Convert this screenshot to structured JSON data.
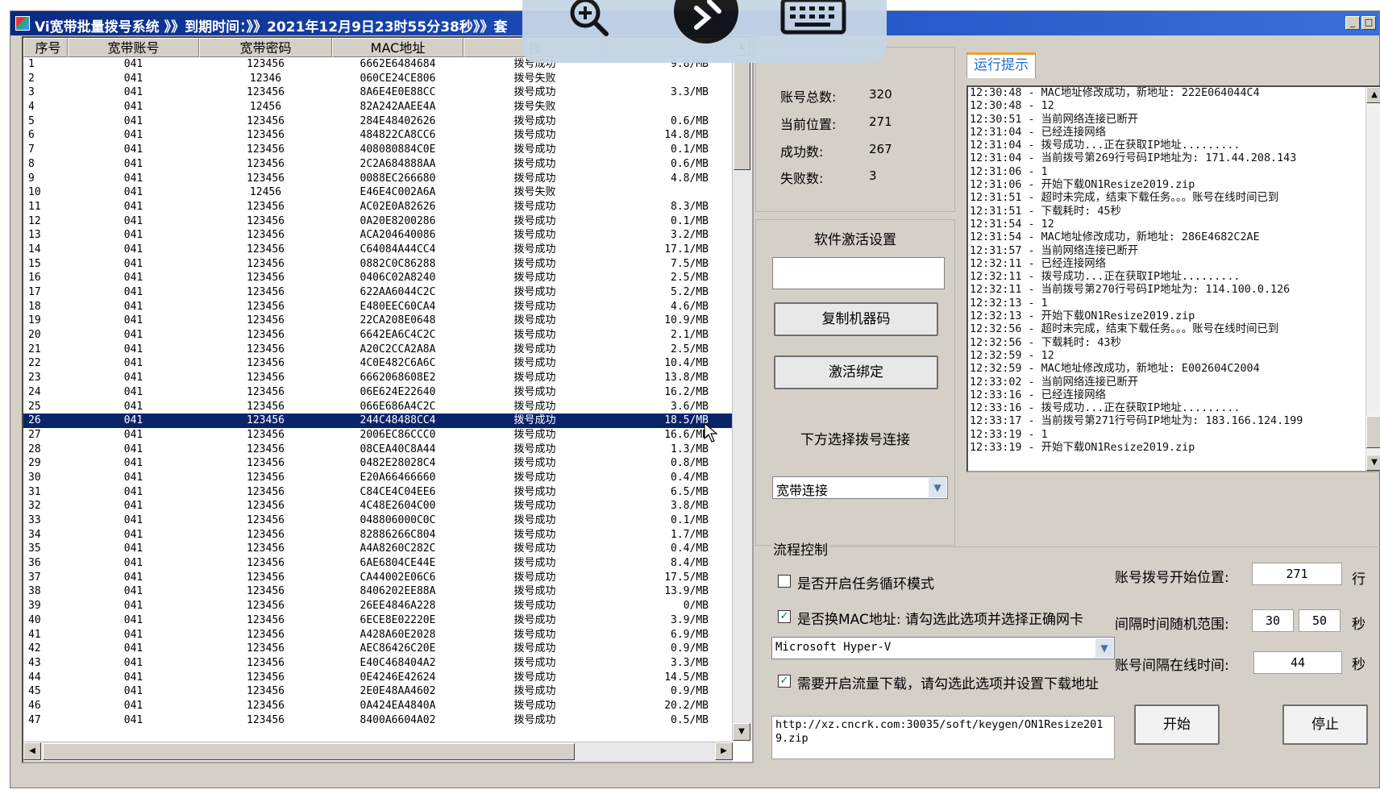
{
  "window": {
    "title": "Vi宽带批量拨号系统 》》到期时间：》》2021年12月9日23时55分38秒》》套"
  },
  "table": {
    "headers": [
      "序号",
      "宽带账号",
      "宽带密码",
      "MAC地址",
      "拨",
      ""
    ],
    "rows": [
      [
        "1",
        "041",
        "123456",
        "6662E6484684",
        "拨号成功",
        "9.8/MB"
      ],
      [
        "2",
        "041",
        "12346",
        "060CE24CE806",
        "拨号失败",
        ""
      ],
      [
        "3",
        "041",
        "123456",
        "8A6E4E0E88CC",
        "拨号成功",
        "3.3/MB"
      ],
      [
        "4",
        "041",
        "12456",
        "82A242AAEE4A",
        "拨号失败",
        ""
      ],
      [
        "5",
        "041",
        "123456",
        "284E48402626",
        "拨号成功",
        "0.6/MB"
      ],
      [
        "6",
        "041",
        "123456",
        "484822CA8CC6",
        "拨号成功",
        "14.8/MB"
      ],
      [
        "7",
        "041",
        "123456",
        "408080884C0E",
        "拨号成功",
        "0.1/MB"
      ],
      [
        "8",
        "041",
        "123456",
        "2C2A684888AA",
        "拨号成功",
        "0.6/MB"
      ],
      [
        "9",
        "041",
        "123456",
        "0088EC266680",
        "拨号成功",
        "4.8/MB"
      ],
      [
        "10",
        "041",
        "12456",
        "E46E4C002A6A",
        "拨号失败",
        ""
      ],
      [
        "11",
        "041",
        "123456",
        "AC02E0A82626",
        "拨号成功",
        "8.3/MB"
      ],
      [
        "12",
        "041",
        "123456",
        "0A20E8200286",
        "拨号成功",
        "0.1/MB"
      ],
      [
        "13",
        "041",
        "123456",
        "ACA204640086",
        "拨号成功",
        "3.2/MB"
      ],
      [
        "14",
        "041",
        "123456",
        "C64084A44CC4",
        "拨号成功",
        "17.1/MB"
      ],
      [
        "15",
        "041",
        "123456",
        "0882C0C86288",
        "拨号成功",
        "7.5/MB"
      ],
      [
        "16",
        "041",
        "123456",
        "0406C02A8240",
        "拨号成功",
        "2.5/MB"
      ],
      [
        "17",
        "041",
        "123456",
        "622AA6044C2C",
        "拨号成功",
        "5.2/MB"
      ],
      [
        "18",
        "041",
        "123456",
        "E480EEC60CA4",
        "拨号成功",
        "4.6/MB"
      ],
      [
        "19",
        "041",
        "123456",
        "22CA208E0648",
        "拨号成功",
        "10.9/MB"
      ],
      [
        "20",
        "041",
        "123456",
        "6642EA6C4C2C",
        "拨号成功",
        "2.1/MB"
      ],
      [
        "21",
        "041",
        "123456",
        "A20C2CCA2A8A",
        "拨号成功",
        "2.5/MB"
      ],
      [
        "22",
        "041",
        "123456",
        "4C0E482C6A6C",
        "拨号成功",
        "10.4/MB"
      ],
      [
        "23",
        "041",
        "123456",
        "6662068608E2",
        "拨号成功",
        "13.8/MB"
      ],
      [
        "24",
        "041",
        "123456",
        "06E624E22640",
        "拨号成功",
        "16.2/MB"
      ],
      [
        "25",
        "041",
        "123456",
        "066E686A4C2C",
        "拨号成功",
        "3.6/MB"
      ],
      [
        "26",
        "041",
        "123456",
        "244C48488CC4",
        "拨号成功",
        "18.5/MB"
      ],
      [
        "27",
        "041",
        "123456",
        "2006EC86CCC0",
        "拨号成功",
        "16.6/MB"
      ],
      [
        "28",
        "041",
        "123456",
        "08CEA40C8A44",
        "拨号成功",
        "1.3/MB"
      ],
      [
        "29",
        "041",
        "123456",
        "0482E28028C4",
        "拨号成功",
        "0.8/MB"
      ],
      [
        "30",
        "041",
        "123456",
        "E20A66466660",
        "拨号成功",
        "0.4/MB"
      ],
      [
        "31",
        "041",
        "123456",
        "C84CE4C04EE6",
        "拨号成功",
        "6.5/MB"
      ],
      [
        "32",
        "041",
        "123456",
        "4C48E2604C00",
        "拨号成功",
        "3.8/MB"
      ],
      [
        "33",
        "041",
        "123456",
        "048806000C0C",
        "拨号成功",
        "0.1/MB"
      ],
      [
        "34",
        "041",
        "123456",
        "82886266C804",
        "拨号成功",
        "1.7/MB"
      ],
      [
        "35",
        "041",
        "123456",
        "A4A8260C282C",
        "拨号成功",
        "0.4/MB"
      ],
      [
        "36",
        "041",
        "123456",
        "6AE6804CE44E",
        "拨号成功",
        "8.4/MB"
      ],
      [
        "37",
        "041",
        "123456",
        "CA44002E06C6",
        "拨号成功",
        "17.5/MB"
      ],
      [
        "38",
        "041",
        "123456",
        "8406202EE88A",
        "拨号成功",
        "13.9/MB"
      ],
      [
        "39",
        "041",
        "123456",
        "26EE4846A228",
        "拨号成功",
        "0/MB"
      ],
      [
        "40",
        "041",
        "123456",
        "6ECE8E02220E",
        "拨号成功",
        "3.9/MB"
      ],
      [
        "41",
        "041",
        "123456",
        "A428A60E2028",
        "拨号成功",
        "6.9/MB"
      ],
      [
        "42",
        "041",
        "123456",
        "AEC86426C20E",
        "拨号成功",
        "0.9/MB"
      ],
      [
        "43",
        "041",
        "123456",
        "E40C468404A2",
        "拨号成功",
        "3.3/MB"
      ],
      [
        "44",
        "041",
        "123456",
        "0E4246E42624",
        "拨号成功",
        "14.5/MB"
      ],
      [
        "45",
        "041",
        "123456",
        "2E0E48AA4602",
        "拨号成功",
        "0.9/MB"
      ],
      [
        "46",
        "041",
        "123456",
        "0A424EA4840A",
        "拨号成功",
        "20.2/MB"
      ],
      [
        "47",
        "041",
        "123456",
        "8400A6604A02",
        "拨号成功",
        "0.5/MB"
      ]
    ],
    "selected_row": 25
  },
  "stats": {
    "total_label": "账号总数:",
    "total_value": "320",
    "position_label": "当前位置:",
    "position_value": "271",
    "success_label": "成功数:",
    "success_value": "267",
    "fail_label": "失败数:",
    "fail_value": "3"
  },
  "activation": {
    "title": "软件激活设置",
    "input_value": "",
    "copy_button": "复制机器码",
    "bind_button": "激活绑定",
    "dial_label": "下方选择拨号连接",
    "dial_select": "宽带连接"
  },
  "log": {
    "tab_label": "运行提示",
    "lines": [
      "12:30:48 - MAC地址修改成功，新地址: 222E064044C4",
      "12:30:48 - 12",
      "12:30:51 - 当前网络连接已断开",
      "12:31:04 - 已经连接网络",
      "12:31:04 - 拨号成功...正在获取IP地址.........",
      "12:31:04 - 当前拨号第269行号码IP地址为: 171.44.208.143",
      "12:31:06 - 1",
      "12:31:06 - 开始下载ON1Resize2019.zip",
      "12:31:51 - 超时未完成，结束下载任务。。。账号在线时间已到",
      "12:31:51 - 下载耗时: 45秒",
      "12:31:54 - 12",
      "12:31:54 - MAC地址修改成功，新地址: 286E4682C2AE",
      "12:31:57 - 当前网络连接已断开",
      "12:32:11 - 已经连接网络",
      "12:32:11 - 拨号成功...正在获取IP地址.........",
      "12:32:11 - 当前拨号第270行号码IP地址为: 114.100.0.126",
      "12:32:13 - 1",
      "12:32:13 - 开始下载ON1Resize2019.zip",
      "12:32:56 - 超时未完成，结束下载任务。。。账号在线时间已到",
      "12:32:56 - 下载耗时: 43秒",
      "12:32:59 - 12",
      "12:32:59 - MAC地址修改成功，新地址: E002604C2004",
      "12:33:02 - 当前网络连接已断开",
      "12:33:16 - 已经连接网络",
      "12:33:16 - 拨号成功...正在获取IP地址.........",
      "12:33:17 - 当前拨号第271行号码IP地址为: 183.166.124.199",
      "12:33:19 - 1",
      "12:33:19 - 开始下载ON1Resize2019.zip"
    ]
  },
  "flow": {
    "group_label": "流程控制",
    "loop_label": "是否开启任务循环模式",
    "loop_checked": false,
    "mac_label": "是否换MAC地址: 请勾选此选项并选择正确网卡",
    "mac_checked": true,
    "nic_select": "Microsoft Hyper-V",
    "download_label": "需要开启流量下载，请勾选此选项并设置下载地址",
    "download_checked": true,
    "url": "http://xz.cncrk.com:30035/soft/keygen/ON1Resize2019.zip",
    "start_pos_label": "账号拨号开始位置:",
    "start_pos_value": "271",
    "start_pos_unit": "行",
    "interval_label": "间隔时间随机范围:",
    "interval_min": "30",
    "interval_max": "50",
    "interval_unit": "秒",
    "online_label": "账号间隔在线时间:",
    "online_value": "44",
    "online_unit": "秒",
    "start_button": "开始",
    "stop_button": "停止"
  },
  "overlay_icons": [
    "zoom-in-icon",
    "remote-connect-icon",
    "keyboard-icon"
  ],
  "colors": {
    "titlebar": "#0a2a82",
    "selection": "#0a246a",
    "tab_accent": "#f0a030",
    "tab_text": "#1f6fd0"
  }
}
